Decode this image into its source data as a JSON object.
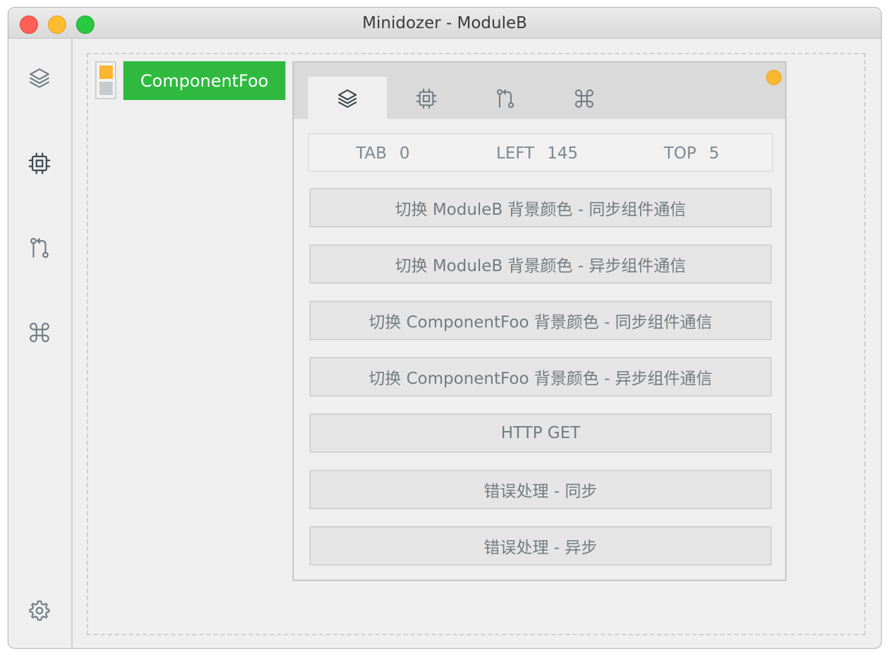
{
  "window": {
    "title": "Minidozer - ModuleB"
  },
  "sidebar": {
    "items": [
      {
        "icon": "layers-icon"
      },
      {
        "icon": "cpu-icon"
      },
      {
        "icon": "git-pull-request-icon"
      },
      {
        "icon": "command-icon"
      }
    ],
    "footer_icon": "settings-icon"
  },
  "component": {
    "label": "ComponentFoo"
  },
  "swatches": {
    "colors": [
      "#fbb731",
      "#c6cbce"
    ]
  },
  "panel": {
    "status_dot_color": "#fbb731",
    "tabs": [
      {
        "icon": "layers-icon",
        "active": true
      },
      {
        "icon": "cpu-icon",
        "active": false
      },
      {
        "icon": "git-pull-request-icon",
        "active": false
      },
      {
        "icon": "command-icon",
        "active": false
      }
    ],
    "info": {
      "tab_label": "TAB",
      "tab_value": "0",
      "left_label": "LEFT",
      "left_value": "145",
      "top_label": "TOP",
      "top_value": "5"
    },
    "buttons": [
      "切换 ModuleB 背景颜色 - 同步组件通信",
      "切换 ModuleB 背景颜色 - 异步组件通信",
      "切换 ComponentFoo 背景颜色 - 同步组件通信",
      "切换 ComponentFoo 背景颜色 - 异步组件通信",
      "HTTP GET",
      "错误处理 - 同步",
      "错误处理 - 异步"
    ]
  },
  "colors": {
    "accent_green": "#2fba3f",
    "accent_orange": "#fbb731"
  }
}
